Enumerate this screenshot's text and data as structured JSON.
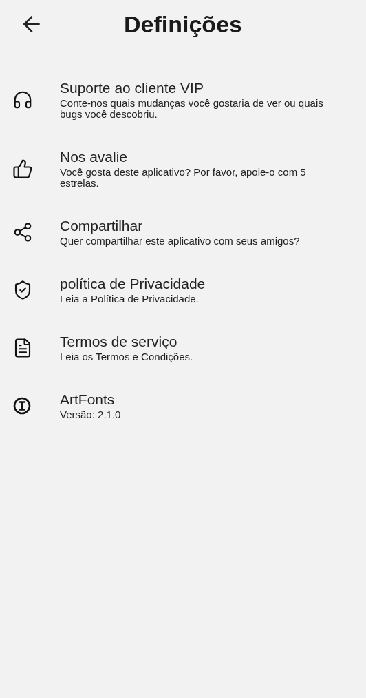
{
  "header": {
    "title": "Definições"
  },
  "items": [
    {
      "kind": "headset",
      "title": "Suporte ao cliente VIP",
      "description": "Conte-nos quais mudanças você gostaria de ver ou quais bugs você descobriu."
    },
    {
      "kind": "thumbs-up",
      "title": "Nos avalie",
      "description": "Você gosta deste aplicativo? Por favor, apoie-o com 5 estrelas."
    },
    {
      "kind": "share",
      "title": "Compartilhar",
      "description": "Quer compartilhar este aplicativo com seus amigos?"
    },
    {
      "kind": "shield",
      "title": "política de Privacidade",
      "description": "Leia a Política de Privacidade."
    },
    {
      "kind": "document",
      "title": "Termos de serviço",
      "description": "Leia os Termos e Condições."
    },
    {
      "kind": "info",
      "title": "ArtFonts",
      "description": "Versão: 2.1.0"
    }
  ]
}
